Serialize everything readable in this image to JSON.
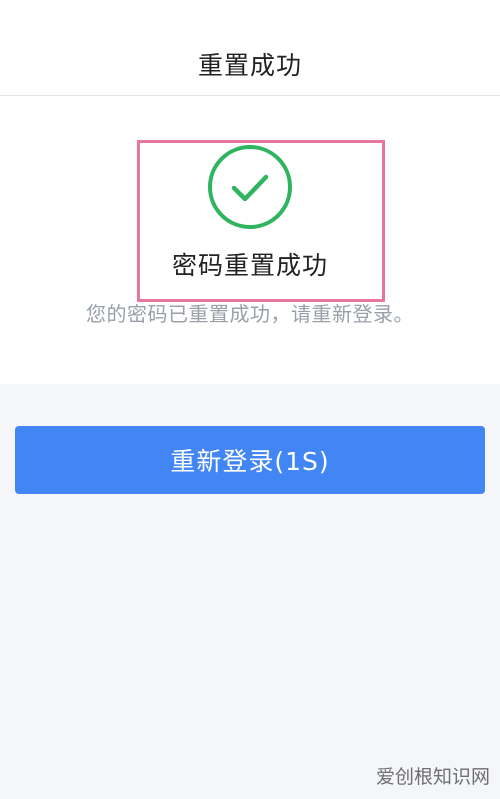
{
  "header": {
    "title": "重置成功"
  },
  "result": {
    "icon": "check-circle-icon",
    "title": "密码重置成功",
    "description": "您的密码已重置成功，请重新登录。"
  },
  "actions": {
    "relogin_label": "重新登录(1S)"
  },
  "watermark": {
    "text": "爱创根知识网"
  },
  "colors": {
    "success": "#2fb45f",
    "primary": "#4285f4",
    "highlight": "#e5789a",
    "page_bg": "#f4f6f9"
  }
}
